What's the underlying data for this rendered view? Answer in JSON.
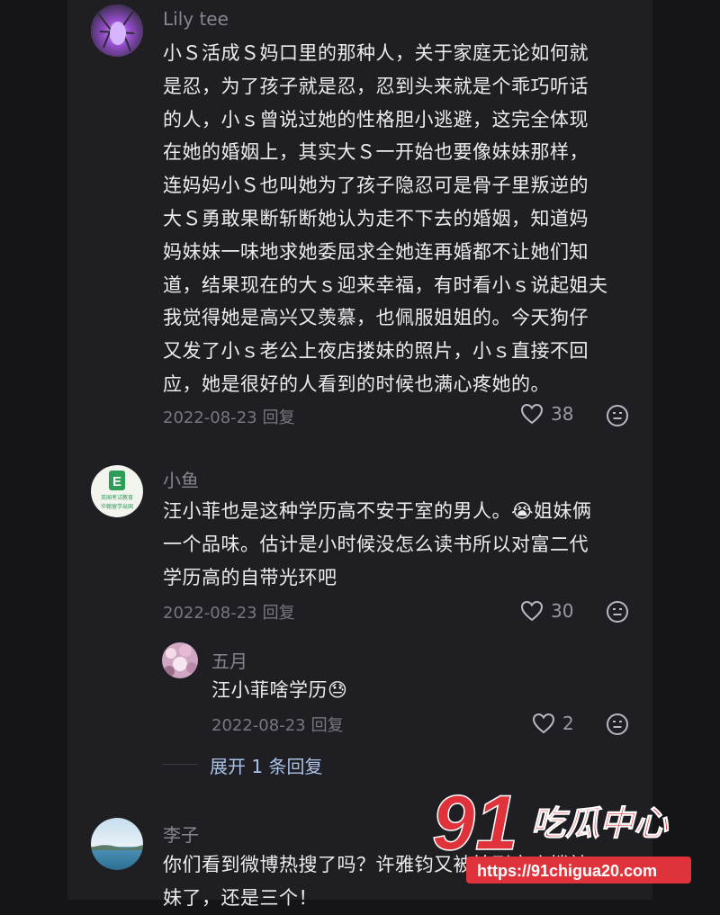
{
  "comments": [
    {
      "author": "Lily tee",
      "lines": [
        "小Ｓ活成Ｓ妈口里的那种人，关于家庭无论如何就",
        "是忍，为了孩子就是忍，忍到头来就是个乖巧听话",
        "的人，小ｓ曾说过她的性格胆小逃避，这完全体现",
        "在她的婚姻上，其实大Ｓ一开始也要像妹妹那样，",
        "连妈妈小Ｓ也叫她为了孩子隐忍可是骨子里叛逆的",
        "大Ｓ勇敢果断斩断她认为走不下去的婚姻，知道妈",
        "妈妹妹一味地求她委屈求全她连再婚都不让她们知",
        "道，结果现在的大ｓ迎来幸福，有时看小ｓ说起姐夫",
        "我觉得她是高兴又羡慕，也佩服姐姐的。今天狗仔",
        "又发了小ｓ老公上夜店搂妹的照片，小ｓ直接不回",
        "应，她是很好的人看到的时候也满心疼她的。"
      ],
      "date": "2022-08-23",
      "reply_label": "回复",
      "likes": "38"
    },
    {
      "author": "小鱼",
      "lines": [
        "汪小菲也是这种学历高不安于室的男人。😭姐妹俩",
        "一个品味。估计是小时候没怎么读书所以对富二代",
        "学历高的自带光环吧"
      ],
      "date": "2022-08-23",
      "reply_label": "回复",
      "likes": "30",
      "avatar_text": [
        "英国考试教育",
        "华翰留学出国"
      ],
      "reply": {
        "author": "五月",
        "text": "汪小菲啥学历😓",
        "date": "2022-08-23",
        "reply_label": "回复",
        "likes": "2"
      },
      "expand_label": "展开 1 条回复"
    },
    {
      "author": "李子",
      "lines": [
        "你们看到微博热搜了吗？许雅钧又被拍到夜店搂辣",
        "妹了，还是三个！"
      ]
    }
  ],
  "watermark": {
    "number": "91",
    "brand": "吃瓜中心",
    "url": "https://91chigua20.com"
  },
  "colors": {
    "background": "#151518",
    "panel": "#1f1f23",
    "text": "#ececee",
    "muted": "#77777e",
    "link": "#a9c1e6",
    "watermark": "#e0323b"
  }
}
